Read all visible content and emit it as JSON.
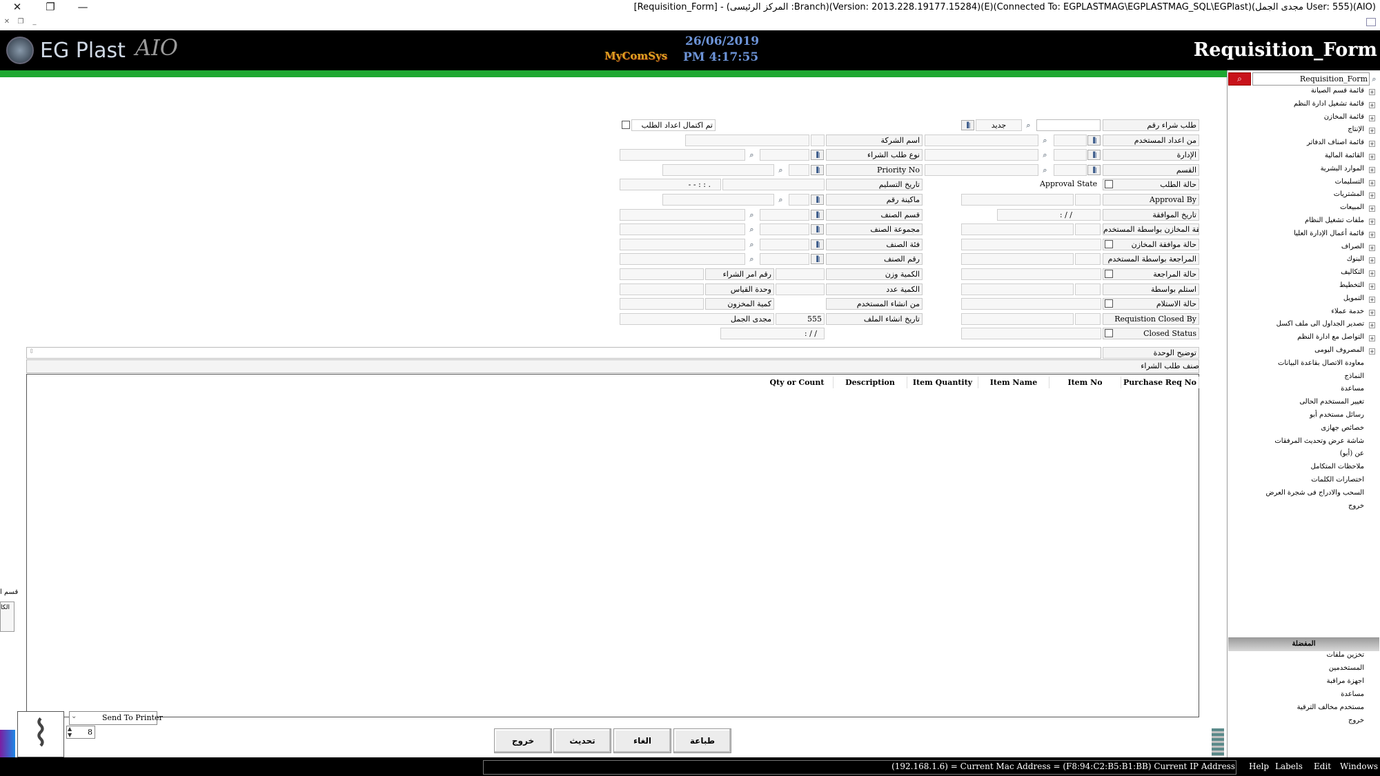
{
  "window": {
    "title": "[Requisition_Form] - (المركز الرئيسى :Branch)(Version: 2013.228.19177.15284)(E)(Connected To: EGPLASTMAG\\EGPLASTMAG_SQL\\EGPlast)(مجدى الجمل User: 555)(AIO)",
    "close": "✕",
    "restore": "❐",
    "minimize": "—"
  },
  "banner": {
    "logo": "EG Plast",
    "logo_suffix": "AIO",
    "brand": "MyComSys",
    "date": "26/06/2019",
    "time": "PM 4:17:55",
    "form_title": "Requisition_Form"
  },
  "search": {
    "value": "Requisition_Form"
  },
  "tree": [
    "قائمة قسم الصيانة",
    "قائمة تشغيل ادارة النظم",
    "قائمة المخازن",
    "الإنتاج",
    "قائمة اصناف الدفاتر",
    "القائمة المالية",
    "الموارد البشرية",
    "التسليمات",
    "المشتريات",
    "المبيعات",
    "ملفات تشغيل النظام",
    "قائمة أعمال الإدارة العليا",
    "الصراف",
    "البنوك",
    "التكاليف",
    "التخطيط",
    "التمويل",
    "خدمة عملاء",
    "تصدير الجداول الى ملف اكسل",
    "التواصل مع ادارة النظم",
    "المصروف اليومى",
    "معاودة الاتصال بقاعدة البيانات",
    "النماذج",
    "مساعدة",
    "تغيير المستخدم الحالى",
    "رسائل مستخدم أبو",
    "خصائص جهازى",
    "شاشة عرض وتحديث المرفقات",
    "عن (أبو)",
    "ملاحظات المتكامل",
    "اختصارات الكلمات",
    "السحب والادراج فى شجرة العرض",
    "خروج"
  ],
  "favorites": {
    "title": "المفضلة",
    "items": [
      "تخزين ملفات",
      "المستخدمين",
      "اجهزة مراقبة",
      "مساعدة",
      "مستخدم مخالف الترقية",
      "خروج"
    ]
  },
  "form": {
    "right_labels": [
      "طلب شراء رقم",
      "من اعداد المستخدم",
      "الإدارة",
      "القسم",
      "حالة الطلب",
      "Approval By",
      "تاريخ الموافقة",
      "موافقة المخازن بواسطة المستخدم",
      "حالة موافقة المخازن",
      "المراجعة بواسطة المستخدم",
      "حالة المراجعة",
      "استلم بواسطة",
      "حالة الاستلام",
      "Requistion Closed By",
      "Closed Status"
    ],
    "mid_labels": [
      "اسم الشركة",
      "نوع طلب الشراء",
      "Priority No",
      "تاريخ التسليم",
      "ماكينة رقم",
      "قسم الصنف",
      "مجموعة الصنف",
      "فئة الصنف",
      "رقم الصنف",
      "الكمية وزن",
      "الكمية عدد",
      "من انشاء المستخدم",
      "تاريخ انشاء الملف"
    ],
    "new_button": "جديد",
    "approval_state": "Approval State",
    "completion_checkbox": "تم اكتمال اعداد الطلب",
    "purchase_order_no": "رقم امر الشراء",
    "unit_measure": "وحدة القياس",
    "stock_qty": "كمية المخزون",
    "creator_id": "555",
    "creator_name": "مجدى الجمل",
    "date_placeholder": "/  /",
    "time_placeholder": "- -    : : .",
    "approval_date": ":    /  /",
    "file_date": ":      /  /",
    "unit_description": "توضيح الوحدة",
    "grid_caption": "صنف طلب الشراء"
  },
  "grid": {
    "columns": [
      "Purchase Req No",
      "Item No",
      "Item Name",
      "Item Quantity",
      "Description",
      "Qty or Count"
    ]
  },
  "left_stub": {
    "label1": "قسم ا",
    "label2": "الكا"
  },
  "print": {
    "send_label": "Send To Printer",
    "copies": "8"
  },
  "buttons": {
    "print": "طباعة",
    "cancel": "الغاء",
    "update": "تحديث",
    "exit": "خروج"
  },
  "status": {
    "ip": "(192.168.1.6) = Current Mac Address = (F8:94:C2:B5:B1:BB) Current IP Address",
    "menus": [
      "Help",
      "Labels",
      "Edit",
      "Windows"
    ]
  }
}
